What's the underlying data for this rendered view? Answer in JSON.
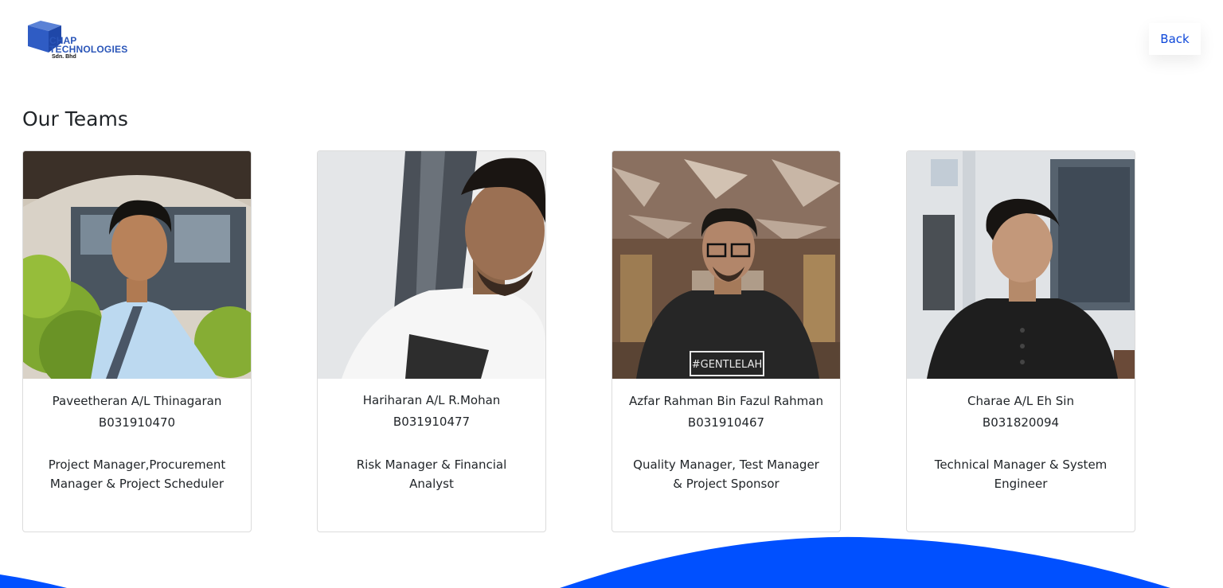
{
  "brand": {
    "line1": "CHAP",
    "line2": "TECHNOLOGIES",
    "line3": "Sdn. Bhd",
    "color": "#2a55b8"
  },
  "nav": {
    "back_label": "Back",
    "link_color": "#0d47d9"
  },
  "page": {
    "title": "Our Teams"
  },
  "team": [
    {
      "name": "Paveetheran A/L Thinagaran",
      "id": "B031910470",
      "role": "Project Manager,Procurement Manager & Project Scheduler"
    },
    {
      "name": "Hariharan A/L R.Mohan",
      "id": "B031910477",
      "role": "Risk Manager & Financial Analyst"
    },
    {
      "name": "Azfar Rahman Bin Fazul Rahman",
      "id": "B031910467",
      "role": "Quality Manager, Test Manager & Project Sponsor"
    },
    {
      "name": "Charae A/L Eh Sin",
      "id": "B031820094",
      "role": "Technical Manager & System Engineer"
    }
  ],
  "decor": {
    "wave_color": "#0050ff"
  }
}
